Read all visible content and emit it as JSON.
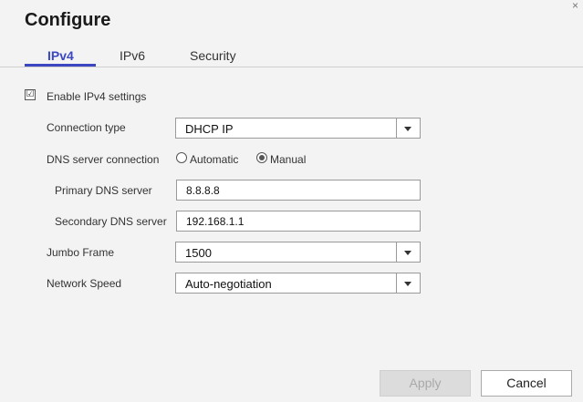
{
  "dialog": {
    "title": "Configure"
  },
  "tabs": [
    {
      "label": "IPv4",
      "active": true
    },
    {
      "label": "IPv6",
      "active": false
    },
    {
      "label": "Security",
      "active": false
    }
  ],
  "enable": {
    "label": "Enable IPv4 settings",
    "checked": true,
    "mark": "☑"
  },
  "connection_type": {
    "label": "Connection type",
    "value": "DHCP IP"
  },
  "dns_connection": {
    "label": "DNS server connection",
    "options": [
      "Automatic",
      "Manual"
    ],
    "selected": "Manual"
  },
  "primary_dns": {
    "label": "Primary DNS server",
    "value": "8.8.8.8"
  },
  "secondary_dns": {
    "label": "Secondary DNS server",
    "value": "192.168.1.1"
  },
  "jumbo_frame": {
    "label": "Jumbo Frame",
    "value": "1500"
  },
  "network_speed": {
    "label": "Network Speed",
    "value": "Auto-negotiation"
  },
  "buttons": {
    "apply": "Apply",
    "cancel": "Cancel"
  },
  "colors": {
    "accent": "#3b47c0",
    "background": "#f3f3f3"
  }
}
